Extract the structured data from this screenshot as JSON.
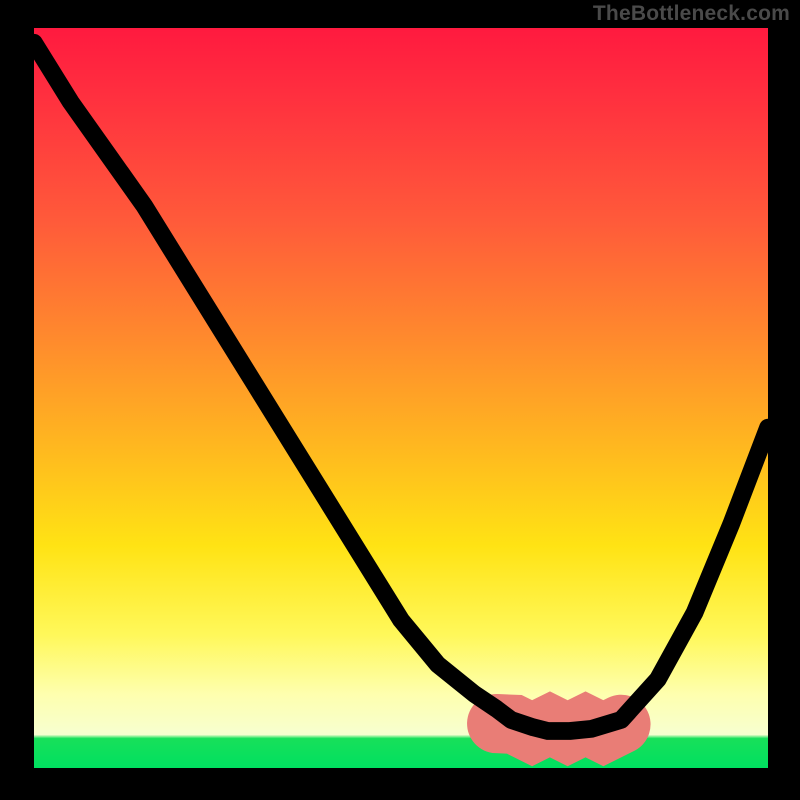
{
  "watermark": "TheBottleneck.com",
  "chart_data": {
    "type": "line",
    "title": "",
    "xlabel": "",
    "ylabel": "",
    "xlim": [
      0,
      100
    ],
    "ylim": [
      0,
      100
    ],
    "grid": false,
    "series": [
      {
        "name": "main-curve",
        "x": [
          0,
          5,
          10,
          15,
          20,
          25,
          30,
          35,
          40,
          45,
          50,
          55,
          60,
          63,
          65,
          68,
          70,
          73,
          76,
          80,
          85,
          90,
          95,
          100
        ],
        "y_percent_from_top": [
          2,
          10,
          17,
          24,
          32,
          40,
          48,
          56,
          64,
          72,
          80,
          86,
          90,
          92,
          93.5,
          94.5,
          95,
          95,
          94.7,
          93.5,
          88,
          79,
          67,
          54
        ],
        "color": "#000000"
      },
      {
        "name": "highlight-band",
        "x": [
          63,
          80
        ],
        "y_percent_from_top": [
          94.7,
          94.7
        ],
        "color": "#e97d76"
      }
    ],
    "gradient_stops": [
      {
        "pos": 0.0,
        "color": "#ff1a3f"
      },
      {
        "pos": 0.09,
        "color": "#ff2f3f"
      },
      {
        "pos": 0.26,
        "color": "#ff5a3a"
      },
      {
        "pos": 0.42,
        "color": "#ff8a2d"
      },
      {
        "pos": 0.57,
        "color": "#ffb91f"
      },
      {
        "pos": 0.7,
        "color": "#ffe314"
      },
      {
        "pos": 0.82,
        "color": "#fff85a"
      },
      {
        "pos": 0.9,
        "color": "#feffae"
      },
      {
        "pos": 0.955,
        "color": "#f7ffd0"
      },
      {
        "pos": 0.96,
        "color": "#18e05a"
      },
      {
        "pos": 1.0,
        "color": "#00e060"
      }
    ]
  }
}
